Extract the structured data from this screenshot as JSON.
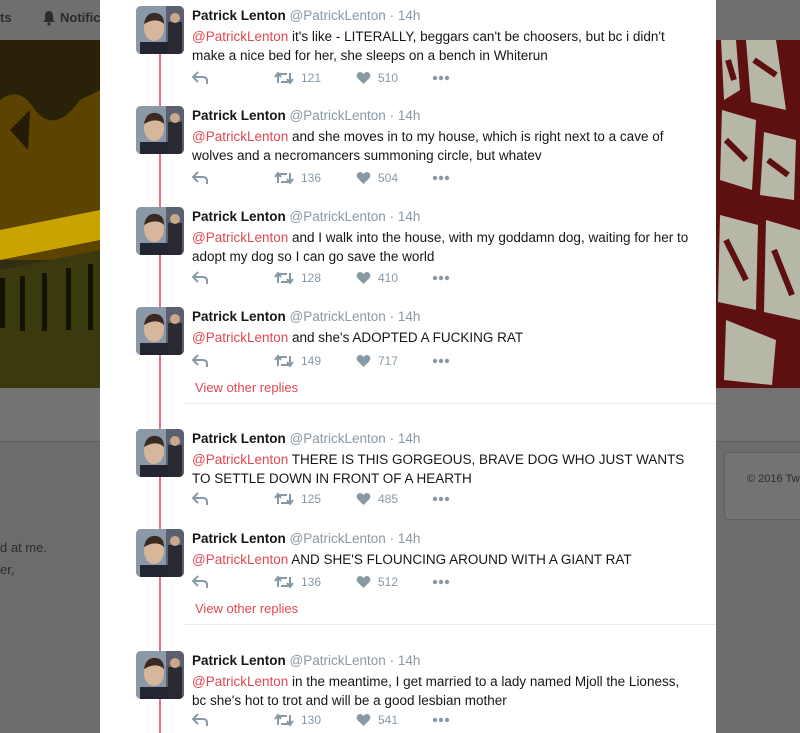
{
  "background": {
    "nav_left_fragment": "ts",
    "nav_notifications_fragment": "Notifica",
    "copyright": "© 2016 Tw",
    "text_line_1": "d at me.",
    "text_line_2": "er,"
  },
  "colors": {
    "accent": "#e0484f",
    "thread_line": "#e8737a",
    "muted": "#8899a6",
    "text": "#14171a"
  },
  "tweets": [
    {
      "name": "Patrick Lenton",
      "handle": "@PatrickLenton",
      "separator": "·",
      "time": "14h",
      "mention": "@PatrickLenton",
      "text": " it's like - LITERALLY, beggars can't be choosers, but bc i didn't make a nice bed for her, she sleeps on a bench in Whiterun",
      "retweets": "121",
      "likes": "510"
    },
    {
      "name": "Patrick Lenton",
      "handle": "@PatrickLenton",
      "separator": "·",
      "time": "14h",
      "mention": "@PatrickLenton",
      "text": " and she moves in to my house, which is right next to a cave of wolves and a necromancers summoning circle, but whatev",
      "retweets": "136",
      "likes": "504"
    },
    {
      "name": "Patrick Lenton",
      "handle": "@PatrickLenton",
      "separator": "·",
      "time": "14h",
      "mention": "@PatrickLenton",
      "text": " and I walk into the house, with my goddamn dog, waiting for her to adopt my dog so I can go save the world",
      "retweets": "128",
      "likes": "410"
    },
    {
      "name": "Patrick Lenton",
      "handle": "@PatrickLenton",
      "separator": "·",
      "time": "14h",
      "mention": "@PatrickLenton",
      "text": " and she's ADOPTED A FUCKING RAT",
      "retweets": "149",
      "likes": "717",
      "view_other_replies": "View other replies"
    },
    {
      "name": "Patrick Lenton",
      "handle": "@PatrickLenton",
      "separator": "·",
      "time": "14h",
      "mention": "@PatrickLenton",
      "text": " THERE IS THIS GORGEOUS, BRAVE DOG WHO JUST WANTS TO SETTLE DOWN IN FRONT OF A HEARTH",
      "retweets": "125",
      "likes": "485"
    },
    {
      "name": "Patrick Lenton",
      "handle": "@PatrickLenton",
      "separator": "·",
      "time": "14h",
      "mention": "@PatrickLenton",
      "text": " AND SHE'S FLOUNCING AROUND WITH A GIANT RAT",
      "retweets": "136",
      "likes": "512",
      "view_other_replies": "View other replies"
    },
    {
      "name": "Patrick Lenton",
      "handle": "@PatrickLenton",
      "separator": "·",
      "time": "14h",
      "mention": "@PatrickLenton",
      "text": " in the meantime, I get married to a lady named Mjoll the Lioness, bc she's hot to trot and will be a good lesbian mother",
      "retweets": "130",
      "likes": "541"
    }
  ]
}
